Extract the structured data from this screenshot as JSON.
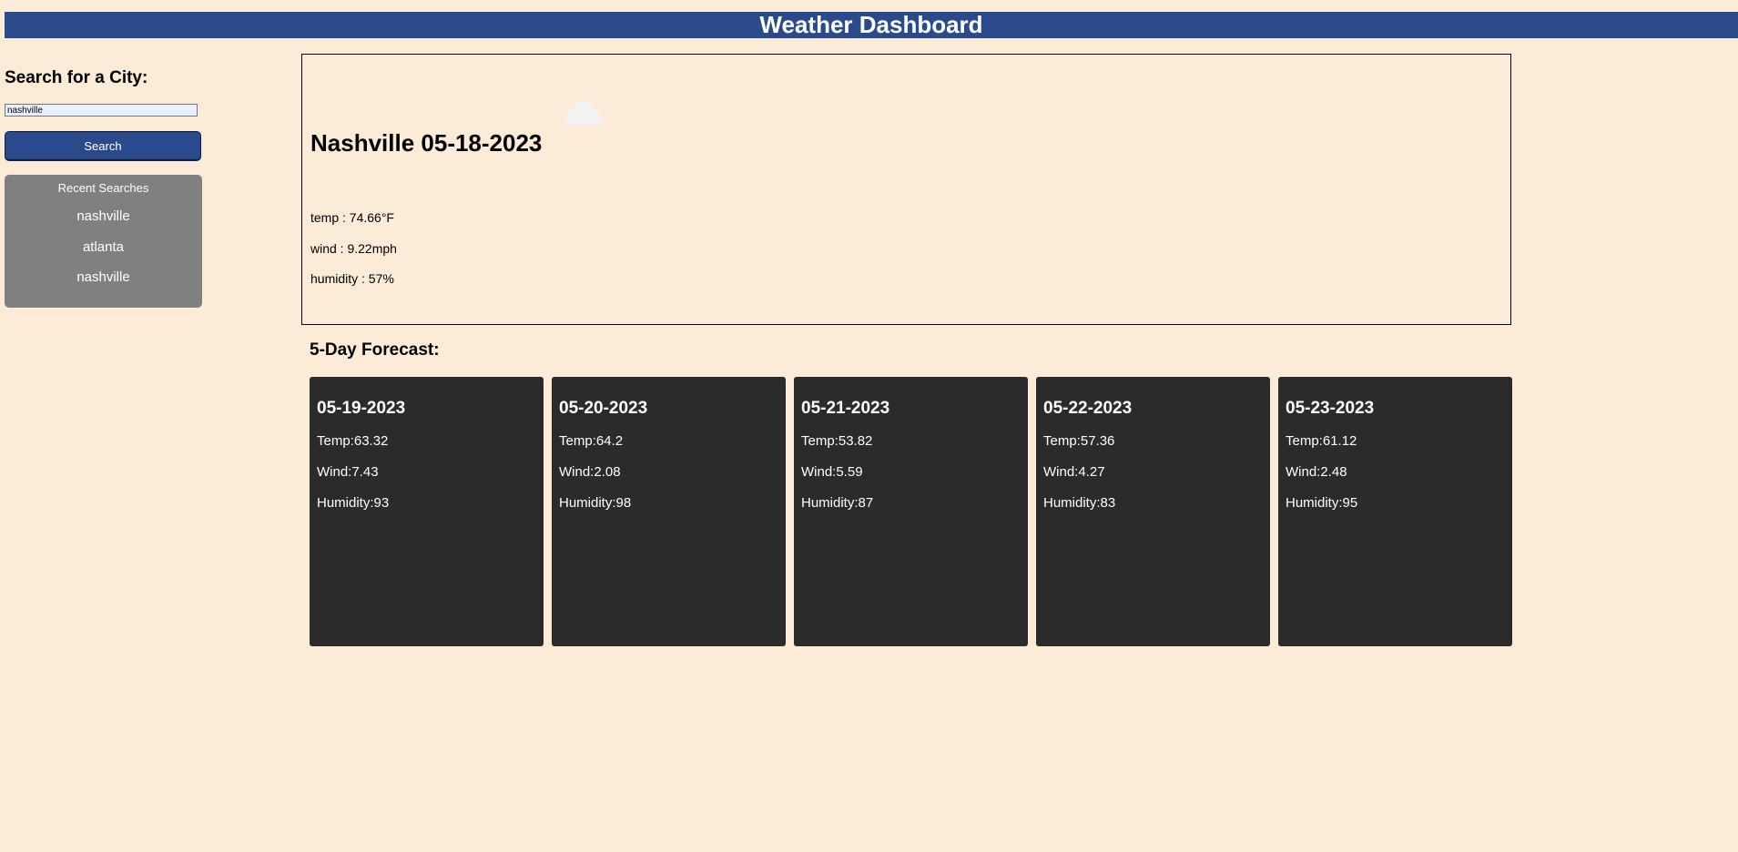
{
  "header": {
    "title": "Weather Dashboard",
    "background_color": "#2b4a8b"
  },
  "sidebar": {
    "heading": "Search for a City:",
    "search_input": {
      "value": "nashville",
      "placeholder": ""
    },
    "search_button_label": "Search",
    "recent": {
      "title": "Recent Searches",
      "items": [
        {
          "label": "nashville"
        },
        {
          "label": "atlanta"
        },
        {
          "label": "nashville"
        }
      ]
    }
  },
  "current": {
    "title": "Nashville 05-18-2023",
    "icon": "cloud-icon",
    "temp": "temp : 74.66°F",
    "wind": "wind : 9.22mph",
    "humidity": "humidity : 57%"
  },
  "forecast": {
    "heading": "5-Day Forecast:",
    "days": [
      {
        "date": "05-19-2023",
        "temp": "Temp:63.32",
        "wind": "Wind:7.43",
        "humidity": "Humidity:93"
      },
      {
        "date": "05-20-2023",
        "temp": "Temp:64.2",
        "wind": "Wind:2.08",
        "humidity": "Humidity:98"
      },
      {
        "date": "05-21-2023",
        "temp": "Temp:53.82",
        "wind": "Wind:5.59",
        "humidity": "Humidity:87"
      },
      {
        "date": "05-22-2023",
        "temp": "Temp:57.36",
        "wind": "Wind:4.27",
        "humidity": "Humidity:83"
      },
      {
        "date": "05-23-2023",
        "temp": "Temp:61.12",
        "wind": "Wind:2.48",
        "humidity": "Humidity:95"
      }
    ]
  },
  "colors": {
    "page_background": "#fbebd7",
    "accent": "#2b4a8b",
    "recent_panel": "#808080",
    "forecast_card": "#2b2b2b"
  }
}
